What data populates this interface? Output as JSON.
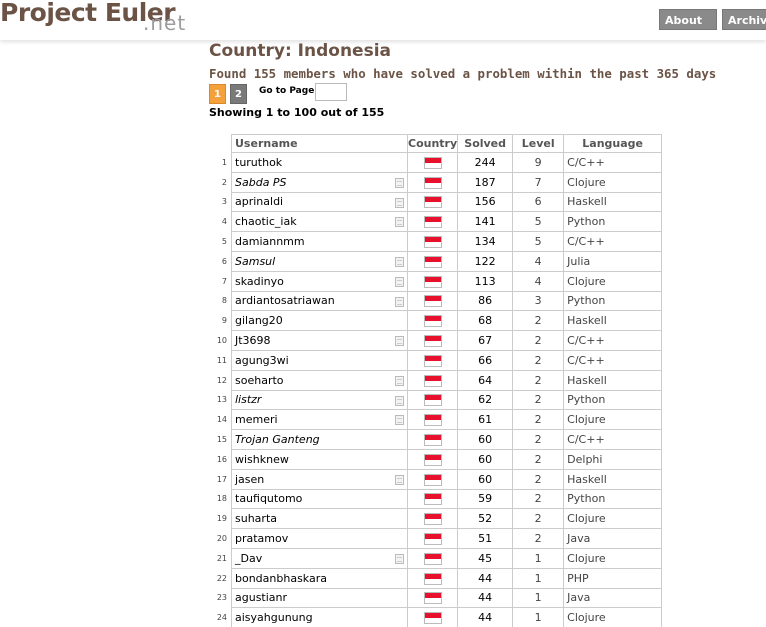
{
  "header": {
    "logo": "Project Euler",
    "logo_tld": ".net",
    "nav": {
      "about": "About",
      "archives": "Archives"
    }
  },
  "title": "Country: Indonesia",
  "found_text": "Found 155 members who have solved a problem within the past 365 days",
  "pagination": {
    "pages": [
      "1",
      "2"
    ],
    "current": "1",
    "goto_label": "Go to Page:"
  },
  "showing": "Showing 1 to 100 out of 155",
  "table": {
    "headers": {
      "username": "Username",
      "country": "Country",
      "solved": "Solved",
      "level": "Level",
      "language": "Language"
    },
    "flag_colors": {
      "top": "#e8112d",
      "bottom": "#ffffff"
    },
    "rows": [
      {
        "rank": "1",
        "username": "turuthok",
        "italic": false,
        "has_doc": false,
        "solved": "244",
        "level": "9",
        "language": "C/C++"
      },
      {
        "rank": "2",
        "username": "Sabda PS",
        "italic": true,
        "has_doc": true,
        "solved": "187",
        "level": "7",
        "language": "Clojure"
      },
      {
        "rank": "3",
        "username": "aprinaldi",
        "italic": false,
        "has_doc": true,
        "solved": "156",
        "level": "6",
        "language": "Haskell"
      },
      {
        "rank": "4",
        "username": "chaotic_iak",
        "italic": false,
        "has_doc": true,
        "solved": "141",
        "level": "5",
        "language": "Python"
      },
      {
        "rank": "5",
        "username": "damiannmm",
        "italic": false,
        "has_doc": false,
        "solved": "134",
        "level": "5",
        "language": "C/C++"
      },
      {
        "rank": "6",
        "username": "Samsul",
        "italic": true,
        "has_doc": true,
        "solved": "122",
        "level": "4",
        "language": "Julia"
      },
      {
        "rank": "7",
        "username": "skadinyo",
        "italic": false,
        "has_doc": true,
        "solved": "113",
        "level": "4",
        "language": "Clojure"
      },
      {
        "rank": "8",
        "username": "ardiantosatriawan",
        "italic": false,
        "has_doc": true,
        "solved": "86",
        "level": "3",
        "language": "Python"
      },
      {
        "rank": "9",
        "username": "gilang20",
        "italic": false,
        "has_doc": false,
        "solved": "68",
        "level": "2",
        "language": "Haskell"
      },
      {
        "rank": "10",
        "username": "Jt3698",
        "italic": false,
        "has_doc": true,
        "solved": "67",
        "level": "2",
        "language": "C/C++"
      },
      {
        "rank": "11",
        "username": "agung3wi",
        "italic": false,
        "has_doc": false,
        "solved": "66",
        "level": "2",
        "language": "C/C++"
      },
      {
        "rank": "12",
        "username": "soeharto",
        "italic": false,
        "has_doc": true,
        "solved": "64",
        "level": "2",
        "language": "Haskell"
      },
      {
        "rank": "13",
        "username": "listzr",
        "italic": true,
        "has_doc": true,
        "solved": "62",
        "level": "2",
        "language": "Python"
      },
      {
        "rank": "14",
        "username": "memeri",
        "italic": false,
        "has_doc": true,
        "solved": "61",
        "level": "2",
        "language": "Clojure"
      },
      {
        "rank": "15",
        "username": "Trojan Ganteng",
        "italic": true,
        "has_doc": false,
        "solved": "60",
        "level": "2",
        "language": "C/C++"
      },
      {
        "rank": "16",
        "username": "wishknew",
        "italic": false,
        "has_doc": false,
        "solved": "60",
        "level": "2",
        "language": "Delphi"
      },
      {
        "rank": "17",
        "username": "jasen",
        "italic": false,
        "has_doc": true,
        "solved": "60",
        "level": "2",
        "language": "Haskell"
      },
      {
        "rank": "18",
        "username": "taufiqutomo",
        "italic": false,
        "has_doc": false,
        "solved": "59",
        "level": "2",
        "language": "Python"
      },
      {
        "rank": "19",
        "username": "suharta",
        "italic": false,
        "has_doc": false,
        "solved": "52",
        "level": "2",
        "language": "Clojure"
      },
      {
        "rank": "20",
        "username": "pratamov",
        "italic": false,
        "has_doc": false,
        "solved": "51",
        "level": "2",
        "language": "Java"
      },
      {
        "rank": "21",
        "username": "_Dav",
        "italic": false,
        "has_doc": true,
        "solved": "45",
        "level": "1",
        "language": "Clojure"
      },
      {
        "rank": "22",
        "username": "bondanbhaskara",
        "italic": false,
        "has_doc": false,
        "solved": "44",
        "level": "1",
        "language": "PHP"
      },
      {
        "rank": "23",
        "username": "agustianr",
        "italic": false,
        "has_doc": false,
        "solved": "44",
        "level": "1",
        "language": "Java"
      },
      {
        "rank": "24",
        "username": "aisyahgunung",
        "italic": false,
        "has_doc": false,
        "solved": "44",
        "level": "1",
        "language": "Clojure"
      }
    ]
  }
}
